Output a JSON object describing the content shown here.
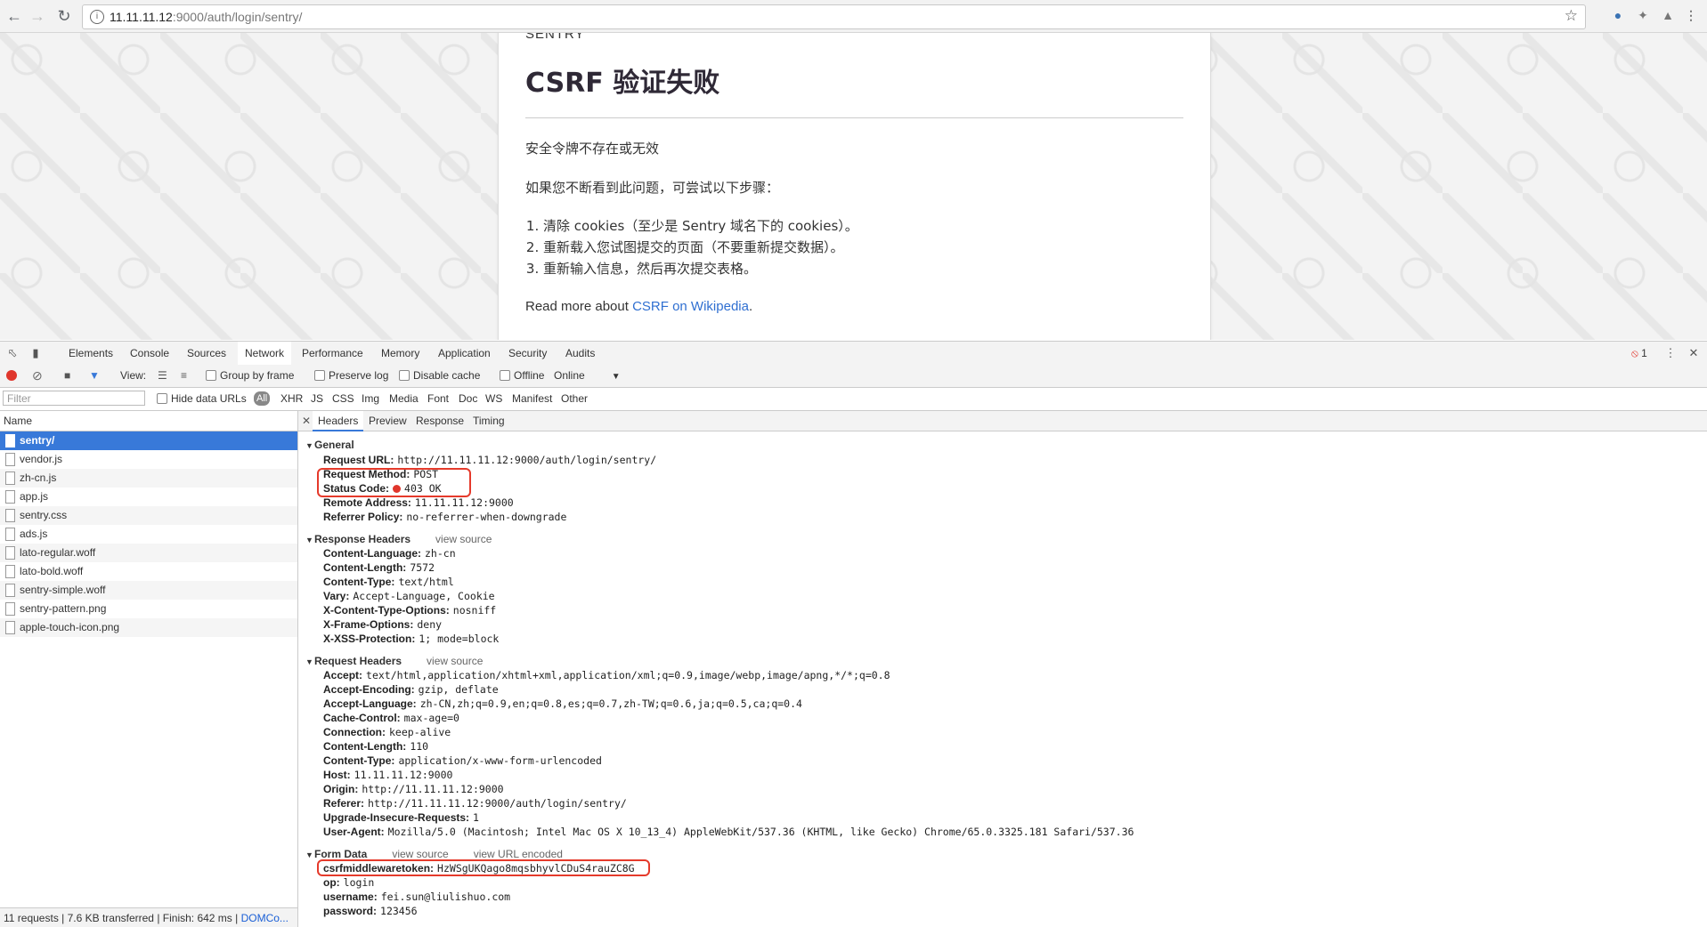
{
  "browser": {
    "url_host": "11.11.11.12",
    "url_rest": ":9000/auth/login/sentry/"
  },
  "page": {
    "logo": "SENTRY",
    "title": "CSRF 验证失败",
    "message": "安全令牌不存在或无效",
    "intro": "如果您不断看到此问题，可尝试以下步骤：",
    "steps": [
      "清除 cookies（至少是 Sentry 域名下的 cookies）。",
      "重新载入您试图提交的页面（不要重新提交数据）。",
      "重新输入信息，然后再次提交表格。"
    ],
    "read_more_prefix": "Read more about ",
    "read_more_link": "CSRF on Wikipedia",
    "read_more_suffix": "."
  },
  "devtools": {
    "tabs": [
      "Elements",
      "Console",
      "Sources",
      "Network",
      "Performance",
      "Memory",
      "Application",
      "Security",
      "Audits"
    ],
    "active_tab": "Network",
    "error_count": "1",
    "toolbar": {
      "view_label": "View:",
      "group_by_frame": "Group by frame",
      "preserve_log": "Preserve log",
      "disable_cache": "Disable cache",
      "offline": "Offline",
      "throttle": "Online"
    },
    "filter": {
      "placeholder": "Filter",
      "hide_data_urls": "Hide data URLs",
      "types": [
        "All",
        "XHR",
        "JS",
        "CSS",
        "Img",
        "Media",
        "Font",
        "Doc",
        "WS",
        "Manifest",
        "Other"
      ]
    },
    "requests_header": "Name",
    "requests": [
      "sentry/",
      "vendor.js",
      "zh-cn.js",
      "app.js",
      "sentry.css",
      "ads.js",
      "lato-regular.woff",
      "lato-bold.woff",
      "sentry-simple.woff",
      "sentry-pattern.png",
      "apple-touch-icon.png"
    ],
    "selected_request": "sentry/",
    "status_bar": {
      "text": "11 requests | 7.6 KB transferred | Finish: 642 ms | ",
      "link": "DOMCo..."
    },
    "detail_tabs": [
      "Headers",
      "Preview",
      "Response",
      "Timing"
    ],
    "active_detail_tab": "Headers",
    "view_source": "view source",
    "view_url_encoded": "view URL encoded",
    "general": {
      "title": "General",
      "rows": [
        {
          "k": "Request URL:",
          "v": "http://11.11.11.12:9000/auth/login/sentry/"
        },
        {
          "k": "Request Method:",
          "v": "POST"
        },
        {
          "k": "Status Code:",
          "v": "403 OK"
        },
        {
          "k": "Remote Address:",
          "v": "11.11.11.12:9000"
        },
        {
          "k": "Referrer Policy:",
          "v": "no-referrer-when-downgrade"
        }
      ]
    },
    "response_headers": {
      "title": "Response Headers",
      "rows": [
        {
          "k": "Content-Language:",
          "v": "zh-cn"
        },
        {
          "k": "Content-Length:",
          "v": "7572"
        },
        {
          "k": "Content-Type:",
          "v": "text/html"
        },
        {
          "k": "Vary:",
          "v": "Accept-Language, Cookie"
        },
        {
          "k": "X-Content-Type-Options:",
          "v": "nosniff"
        },
        {
          "k": "X-Frame-Options:",
          "v": "deny"
        },
        {
          "k": "X-XSS-Protection:",
          "v": "1; mode=block"
        }
      ]
    },
    "request_headers": {
      "title": "Request Headers",
      "rows": [
        {
          "k": "Accept:",
          "v": "text/html,application/xhtml+xml,application/xml;q=0.9,image/webp,image/apng,*/*;q=0.8"
        },
        {
          "k": "Accept-Encoding:",
          "v": "gzip, deflate"
        },
        {
          "k": "Accept-Language:",
          "v": "zh-CN,zh;q=0.9,en;q=0.8,es;q=0.7,zh-TW;q=0.6,ja;q=0.5,ca;q=0.4"
        },
        {
          "k": "Cache-Control:",
          "v": "max-age=0"
        },
        {
          "k": "Connection:",
          "v": "keep-alive"
        },
        {
          "k": "Content-Length:",
          "v": "110"
        },
        {
          "k": "Content-Type:",
          "v": "application/x-www-form-urlencoded"
        },
        {
          "k": "Host:",
          "v": "11.11.11.12:9000"
        },
        {
          "k": "Origin:",
          "v": "http://11.11.11.12:9000"
        },
        {
          "k": "Referer:",
          "v": "http://11.11.11.12:9000/auth/login/sentry/"
        },
        {
          "k": "Upgrade-Insecure-Requests:",
          "v": "1"
        },
        {
          "k": "User-Agent:",
          "v": "Mozilla/5.0 (Macintosh; Intel Mac OS X 10_13_4) AppleWebKit/537.36 (KHTML, like Gecko) Chrome/65.0.3325.181 Safari/537.36"
        }
      ]
    },
    "form_data": {
      "title": "Form Data",
      "rows": [
        {
          "k": "csrfmiddlewaretoken:",
          "v": "HzWSgUKQago8mqsbhyvlCDuS4rauZC8G"
        },
        {
          "k": "op:",
          "v": "login"
        },
        {
          "k": "username:",
          "v": "fei.sun@liulishuo.com"
        },
        {
          "k": "password:",
          "v": "123456"
        }
      ]
    },
    "colors": {
      "accent": "#3879d9",
      "annotation": "#e53a2b",
      "record": "#e0362c"
    }
  }
}
